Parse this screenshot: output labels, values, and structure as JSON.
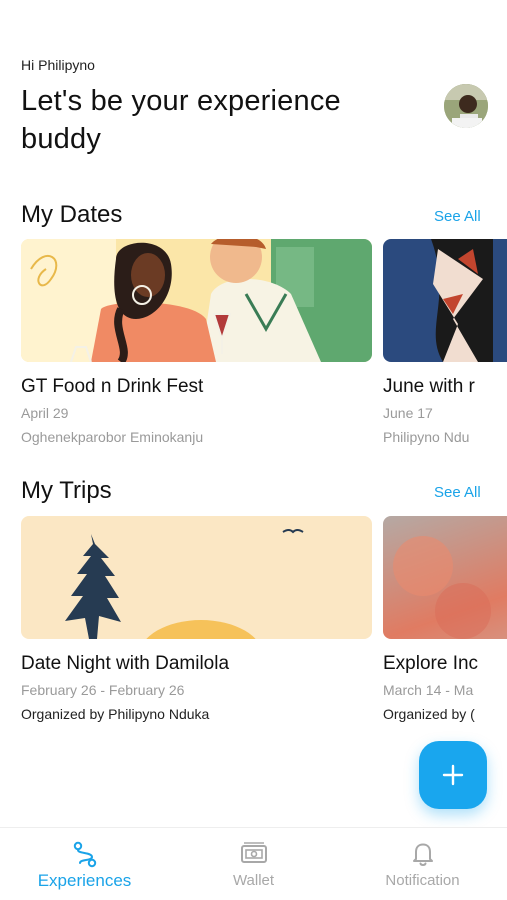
{
  "header": {
    "greeting": "Hi Philipyno",
    "headline": "Let's be your experience buddy"
  },
  "dates": {
    "title": "My Dates",
    "see_all": "See All",
    "cards": [
      {
        "title": "GT Food n Drink Fest",
        "date": "April 29",
        "meta": "Oghenekparobor Eminokanju"
      },
      {
        "title": "June with r",
        "date": "June 17",
        "meta": "Philipyno Ndu"
      }
    ]
  },
  "trips": {
    "title": "My Trips",
    "see_all": "See All",
    "cards": [
      {
        "title": "Date Night with Damilola",
        "date": "February 26 - February 26",
        "meta": "Organized by Philipyno Nduka"
      },
      {
        "title": "Explore Inc",
        "date": "March 14 - Ma",
        "meta": "Organized by ("
      }
    ]
  },
  "fab": {
    "icon": "plus-icon"
  },
  "tabs": [
    {
      "label": "Experiences",
      "icon": "route-icon",
      "active": true
    },
    {
      "label": "Wallet",
      "icon": "wallet-icon",
      "active": false
    },
    {
      "label": "Notification",
      "icon": "bell-icon",
      "active": false
    }
  ],
  "colors": {
    "accent": "#1aa3e8",
    "fab": "#19a6ee",
    "muted": "#9a9a9a"
  }
}
